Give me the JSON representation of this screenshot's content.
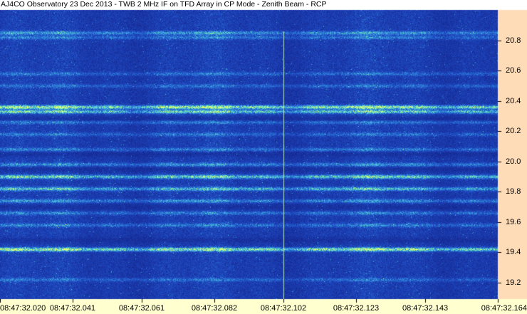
{
  "chart_data": {
    "type": "heatmap",
    "title": "AJ4CO Observatory 23 Dec 2013 - TWB 2 MHz IF on TFD Array in CP Mode - Zenith Beam - RCP",
    "xlabel": "",
    "ylabel": "",
    "x_tick_labels": [
      "08:47:32.020",
      "08:47:32.041",
      "08:47:32.061",
      "08:47:32.082",
      "08:47:32.102",
      "08:47:32.123",
      "08:47:32.143",
      "08:47:32.164"
    ],
    "y_tick_labels": [
      "20.8",
      "20.6",
      "20.4",
      "20.2",
      "20.0",
      "19.8",
      "19.6",
      "19.4",
      "19.2"
    ],
    "y_ticks": [
      20.8,
      20.6,
      20.4,
      20.2,
      20.0,
      19.8,
      19.6,
      19.4,
      19.2
    ],
    "ylim": [
      19.09,
      21.0
    ],
    "x_tick_times_s": [
      0.02,
      0.041,
      0.061,
      0.082,
      0.102,
      0.123,
      0.143,
      0.164
    ],
    "bright_bands_mhz": [
      {
        "freq": 20.85,
        "strength": 0.35
      },
      {
        "freq": 20.82,
        "strength": 0.25
      },
      {
        "freq": 20.58,
        "strength": 0.2
      },
      {
        "freq": 20.5,
        "strength": 0.2
      },
      {
        "freq": 20.36,
        "strength": 0.7
      },
      {
        "freq": 20.33,
        "strength": 0.55
      },
      {
        "freq": 20.26,
        "strength": 0.25
      },
      {
        "freq": 20.18,
        "strength": 0.2
      },
      {
        "freq": 20.08,
        "strength": 0.25
      },
      {
        "freq": 19.98,
        "strength": 0.3
      },
      {
        "freq": 19.9,
        "strength": 0.55
      },
      {
        "freq": 19.82,
        "strength": 0.45
      },
      {
        "freq": 19.74,
        "strength": 0.3
      },
      {
        "freq": 19.66,
        "strength": 0.25
      },
      {
        "freq": 19.58,
        "strength": 0.25
      },
      {
        "freq": 19.42,
        "strength": 0.7
      },
      {
        "freq": 19.22,
        "strength": 0.2
      }
    ],
    "dark_bands_mhz": [
      20.28,
      20.05,
      19.95,
      19.7,
      19.48
    ],
    "vertical_spike_time_s": 0.102,
    "colors": {
      "background_low": "#1a2f9e",
      "mid": "#2f86d6",
      "high": "#7ff0b8",
      "peak": "#d8ff6a",
      "axis_panel": "#ffdcb8",
      "text": "#000000"
    },
    "grid": false,
    "legend": "none"
  }
}
